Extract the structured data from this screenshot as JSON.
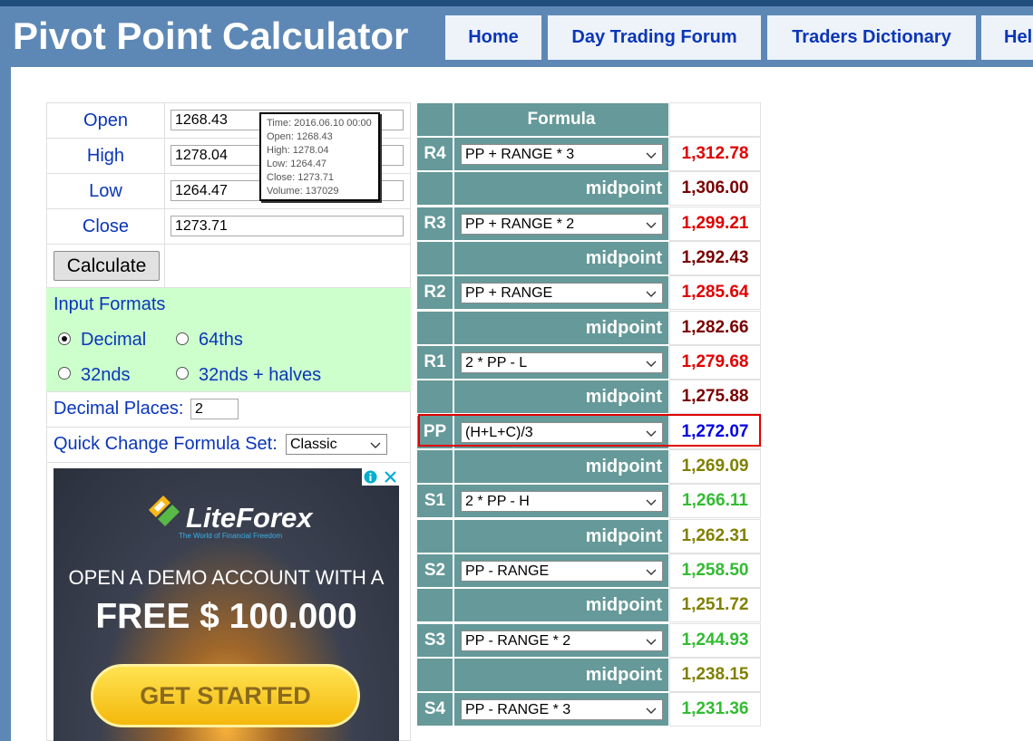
{
  "site_title": "Pivot Point Calculator",
  "nav": [
    "Home",
    "Day Trading Forum",
    "Traders Dictionary",
    "Hel"
  ],
  "inputs": {
    "open_label": "Open",
    "open_value": "1268.43",
    "high_label": "High",
    "high_value": "1278.04",
    "low_label": "Low",
    "low_value": "1264.47",
    "close_label": "Close",
    "close_value": "1273.71"
  },
  "calculate_label": "Calculate",
  "input_formats": {
    "heading": "Input Formats",
    "decimal": "Decimal",
    "sixty_fourths": "64ths",
    "thirty_seconds": "32nds",
    "thirty_seconds_halves": "32nds + halves",
    "selected": "Decimal"
  },
  "decimal_places": {
    "label": "Decimal Places:",
    "value": "2"
  },
  "quick_change": {
    "label": "Quick Change Formula Set:",
    "value": "Classic"
  },
  "tooltip": {
    "time": "Time: 2016.06.10 00:00",
    "open": "Open: 1268.43",
    "high": "High: 1278.04",
    "low": "Low:  1264.47",
    "close": "Close: 1273.71",
    "volume": "Volume: 137029"
  },
  "ad": {
    "brand": "LiteForex",
    "tagline": "The World of Financial Freedom",
    "line1": "OPEN A DEMO ACCOUNT WITH A",
    "line2": "FREE $ 100.000",
    "cta": "GET STARTED"
  },
  "table": {
    "formula_header": "Formula",
    "midpoint_label": "midpoint",
    "rows": [
      {
        "level": "R4",
        "formula": "PP + RANGE * 3",
        "value": "1,312.78",
        "mid": "1,306.00"
      },
      {
        "level": "R3",
        "formula": "PP + RANGE * 2",
        "value": "1,299.21",
        "mid": "1,292.43"
      },
      {
        "level": "R2",
        "formula": "PP + RANGE",
        "value": "1,285.64",
        "mid": "1,282.66"
      },
      {
        "level": "R1",
        "formula": "2 * PP - L",
        "value": "1,279.68",
        "mid": "1,275.88"
      },
      {
        "level": "PP",
        "formula": "(H+L+C)/3",
        "value": "1,272.07",
        "mid": "1,269.09"
      },
      {
        "level": "S1",
        "formula": "2 * PP - H",
        "value": "1,266.11",
        "mid": "1,262.31"
      },
      {
        "level": "S2",
        "formula": "PP - RANGE",
        "value": "1,258.50",
        "mid": "1,251.72"
      },
      {
        "level": "S3",
        "formula": "PP - RANGE * 2",
        "value": "1,244.93",
        "mid": "1,238.15"
      },
      {
        "level": "S4",
        "formula": "PP - RANGE * 3",
        "value": "1,231.36",
        "mid": ""
      }
    ]
  },
  "colors": {
    "header": "#5d88b6",
    "teal": "#669999",
    "resistance": "#e00000",
    "resistance_mid": "#7a0000",
    "pivot": "#0000e0",
    "support": "#33bb33",
    "support_mid": "#808000"
  }
}
